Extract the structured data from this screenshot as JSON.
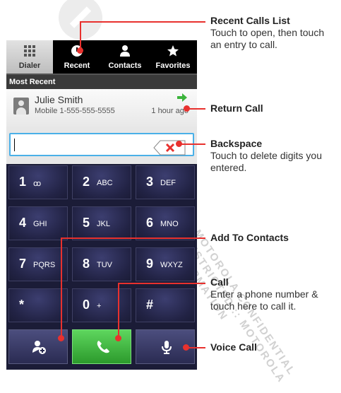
{
  "tabs": [
    {
      "label": "Dialer",
      "icon": "grid-icon"
    },
    {
      "label": "Recent",
      "icon": "clock-icon"
    },
    {
      "label": "Contacts",
      "icon": "person-icon"
    },
    {
      "label": "Favorites",
      "icon": "star-icon"
    }
  ],
  "active_tab": "Dialer",
  "section_header": "Most Recent",
  "recent_entry": {
    "name": "Julie Smith",
    "number": "Mobile 1-555-555-5555",
    "time": "1 hour ago"
  },
  "keypad": [
    {
      "digit": "1",
      "letters": "ꝏ"
    },
    {
      "digit": "2",
      "letters": "ABC"
    },
    {
      "digit": "3",
      "letters": "DEF"
    },
    {
      "digit": "4",
      "letters": "GHI"
    },
    {
      "digit": "5",
      "letters": "JKL"
    },
    {
      "digit": "6",
      "letters": "MNO"
    },
    {
      "digit": "7",
      "letters": "PQRS"
    },
    {
      "digit": "8",
      "letters": "TUV"
    },
    {
      "digit": "9",
      "letters": "WXYZ"
    },
    {
      "digit": "*",
      "letters": ""
    },
    {
      "digit": "0",
      "letters": "+"
    },
    {
      "digit": "#",
      "letters": ""
    }
  ],
  "actions": [
    "add-contact-icon",
    "phone-icon",
    "microphone-icon"
  ],
  "callouts": {
    "recent_calls": {
      "title": "Recent Calls List",
      "desc": "Touch to open, then touch an entry to call."
    },
    "return_call": {
      "title": "Return Call"
    },
    "backspace": {
      "title": "Backspace",
      "desc": "Touch to delete digits you entered."
    },
    "add_to_contacts": {
      "title": "Add To Contacts"
    },
    "call": {
      "title": "Call",
      "desc": "Enter a phone number & touch here to call it."
    },
    "voice_call": {
      "title": "Voice Call"
    }
  },
  "watermark": [
    "MOTOROLA CONFIDENTIAL",
    "RESTRICTED :: MOTOROLA",
    "INFORMATION"
  ],
  "colors": {
    "accent": "#e8312e",
    "call_green": "#3cb43c",
    "input_border": "#4ab0e8",
    "keypad_bg": "#1b1c37"
  }
}
